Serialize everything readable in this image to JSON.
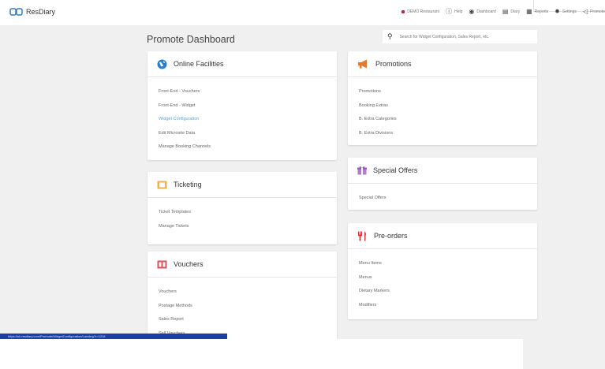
{
  "app": {
    "name": "ResDiary"
  },
  "topnav": {
    "items": [
      {
        "label": "DEMO Restaurant",
        "icon": "status-dot-icon"
      },
      {
        "label": "Help",
        "icon": "help-icon"
      },
      {
        "label": "Dashboard",
        "icon": "dashboard-icon"
      },
      {
        "label": "Diary",
        "icon": "diary-icon"
      },
      {
        "label": "Reports",
        "icon": "reports-icon"
      },
      {
        "label": "Settings",
        "icon": "settings-icon"
      },
      {
        "label": "Promote",
        "icon": "megaphone-icon"
      }
    ]
  },
  "page": {
    "title": "Promote Dashboard"
  },
  "search": {
    "placeholder": "Search for Widget Configuration, Sales Report, etc."
  },
  "cards": {
    "online_facilities": {
      "title": "Online Facilities",
      "links": [
        "Front-End - Vouchers",
        "Front-End - Widget",
        "Widget Configuration",
        "Edit Microsite Data",
        "Manage Booking Channels"
      ]
    },
    "ticketing": {
      "title": "Ticketing",
      "links": [
        "Ticket Templates",
        "Manage Tickets"
      ]
    },
    "vouchers": {
      "title": "Vouchers",
      "links": [
        "Vouchers",
        "Postage Methods",
        "Sales Report",
        "Sell Vouchers"
      ]
    },
    "promotions": {
      "title": "Promotions",
      "links": [
        "Promotions",
        "Booking Extras",
        "B. Extra Categories",
        "B. Extra Divisions"
      ]
    },
    "special_offers": {
      "title": "Special Offers",
      "links": [
        "Special Offers"
      ]
    },
    "preorders": {
      "title": "Pre-orders",
      "links": [
        "Menu Items",
        "Menus",
        "Dietary Markers",
        "Modifiers"
      ]
    }
  },
  "status_bar": {
    "url": "https://uk.resdiary.com/Promote/WidgetConfiguration/Landing?r=1234"
  },
  "colors": {
    "accent_link": "#4aa8dd",
    "brand_blue": "#2c7fc4",
    "status_bar": "#1a3fa6"
  }
}
